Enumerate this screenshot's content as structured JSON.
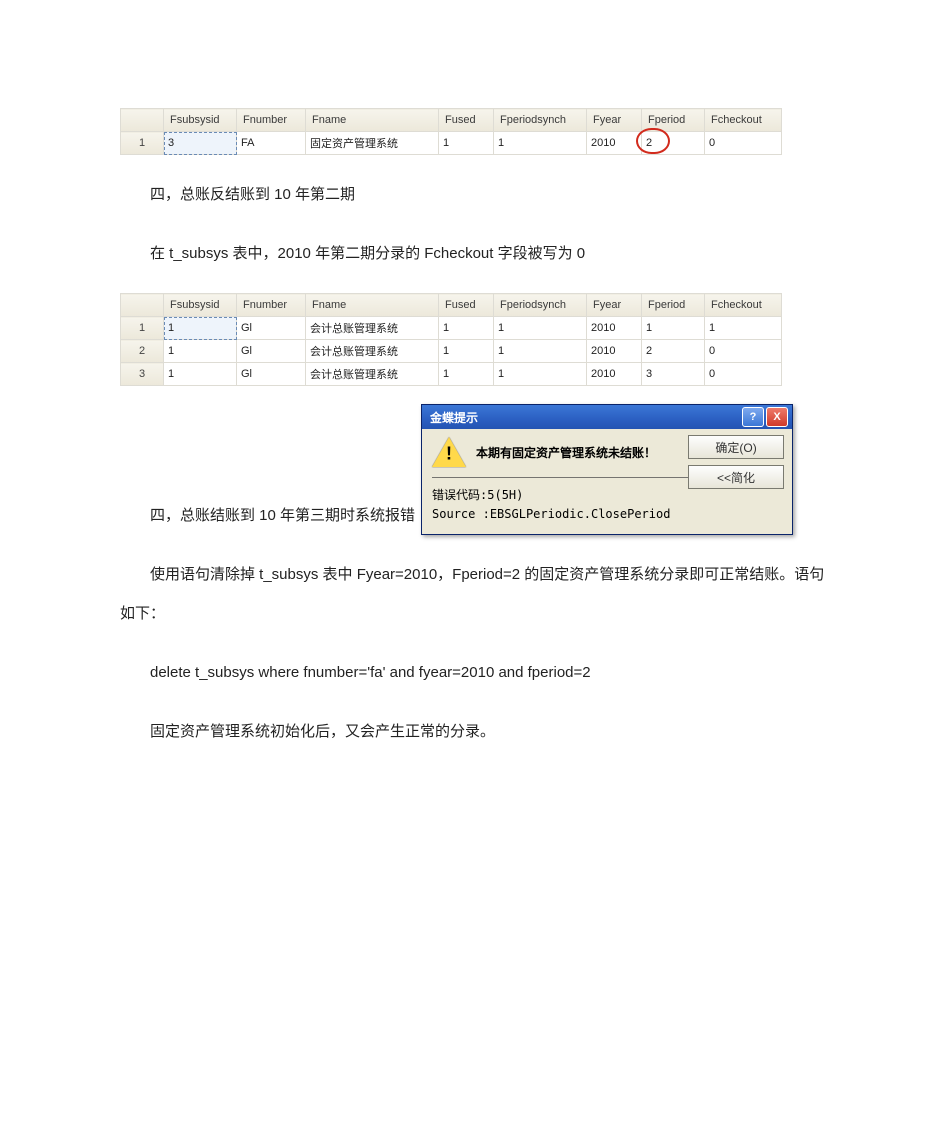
{
  "tables": {
    "headers": [
      "Fsubsysid",
      "Fnumber",
      "Fname",
      "Fused",
      "Fperiodsynch",
      "Fyear",
      "Fperiod",
      "Fcheckout"
    ],
    "table_a_rows": [
      {
        "n": "1",
        "cells": [
          "3",
          "FA",
          "固定资产管理系统",
          "1",
          "1",
          "2010",
          "2",
          "0"
        ],
        "circle_index": 6
      }
    ],
    "table_b_rows": [
      {
        "n": "1",
        "cells": [
          "1",
          "Gl",
          "会计总账管理系统",
          "1",
          "1",
          "2010",
          "1",
          "1"
        ]
      },
      {
        "n": "2",
        "cells": [
          "1",
          "Gl",
          "会计总账管理系统",
          "1",
          "1",
          "2010",
          "2",
          "0"
        ]
      },
      {
        "n": "3",
        "cells": [
          "1",
          "Gl",
          "会计总账管理系统",
          "1",
          "1",
          "2010",
          "3",
          "0"
        ]
      }
    ]
  },
  "paragraphs": {
    "p1": "四，总账反结账到 10 年第二期",
    "p2": "在 t_subsys 表中，2010 年第二期分录的 Fcheckout 字段被写为 0",
    "p3": "四，总账结账到 10 年第三期时系统报错",
    "p4": "使用语句清除掉 t_subsys 表中 Fyear=2010，Fperiod=2 的固定资产管理系统分录即可正常结账。语句如下：",
    "p5": "delete t_subsys where fnumber='fa' and fyear=2010 and fperiod=2",
    "p6": "固定资产管理系统初始化后，又会产生正常的分录。"
  },
  "dialog": {
    "title": "金蝶提示",
    "message": "本期有固定资产管理系统未结账！",
    "ok_label": "确定(O)",
    "detail_label": "<<简化",
    "err_code_label": "错误代码:5(5H)",
    "source_label": "Source   :EBSGLPeriodic.ClosePeriod",
    "help_glyph": "?",
    "close_glyph": "X"
  }
}
